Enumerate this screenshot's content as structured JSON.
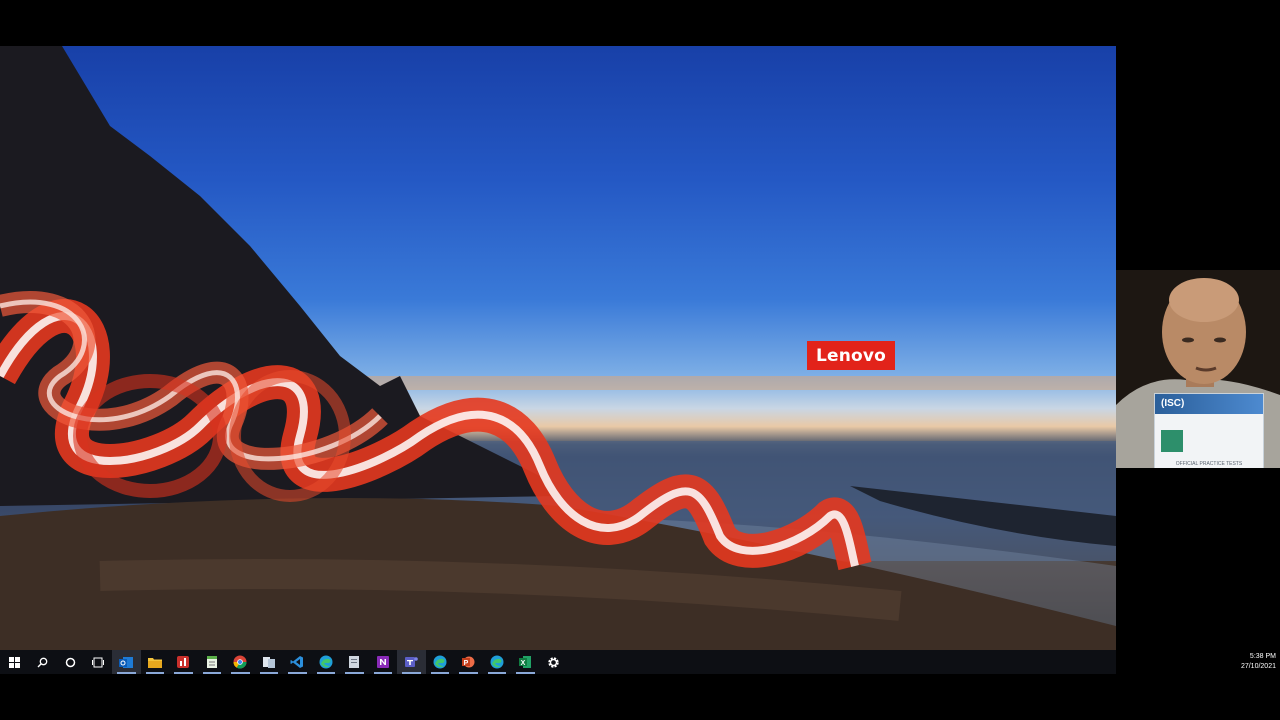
{
  "desktop": {
    "wallpaper_logo": "Lenovo",
    "accent_red": "#e2231a"
  },
  "taskbar": {
    "start_icon": "windows-logo-icon",
    "search_icon": "search-icon",
    "cortana_icon": "cortana-circle-icon",
    "task_view_icon": "task-view-icon",
    "apps": [
      {
        "name": "outlook",
        "icon": "outlook-icon"
      },
      {
        "name": "file-explorer",
        "icon": "folder-icon"
      },
      {
        "name": "app-red-chart",
        "icon": "chart-app-icon"
      },
      {
        "name": "notepad",
        "icon": "notepad-icon"
      },
      {
        "name": "chrome",
        "icon": "chrome-icon"
      },
      {
        "name": "file-manager",
        "icon": "files-icon"
      },
      {
        "name": "vscode",
        "icon": "vscode-icon"
      },
      {
        "name": "edge",
        "icon": "edge-icon"
      },
      {
        "name": "document",
        "icon": "document-icon"
      },
      {
        "name": "onenote",
        "icon": "onenote-icon"
      },
      {
        "name": "teams",
        "icon": "teams-icon"
      },
      {
        "name": "edge-2",
        "icon": "edge-icon"
      },
      {
        "name": "powerpoint",
        "icon": "powerpoint-icon"
      },
      {
        "name": "edge-3",
        "icon": "edge-icon"
      },
      {
        "name": "excel",
        "icon": "excel-icon"
      },
      {
        "name": "settings",
        "icon": "gear-icon"
      }
    ],
    "clock_time": "5:38 PM",
    "clock_date": "27/10/2021"
  },
  "webcam": {
    "book_logo": "(ISC)",
    "book_footer": "OFFICIAL PRACTICE TESTS"
  }
}
